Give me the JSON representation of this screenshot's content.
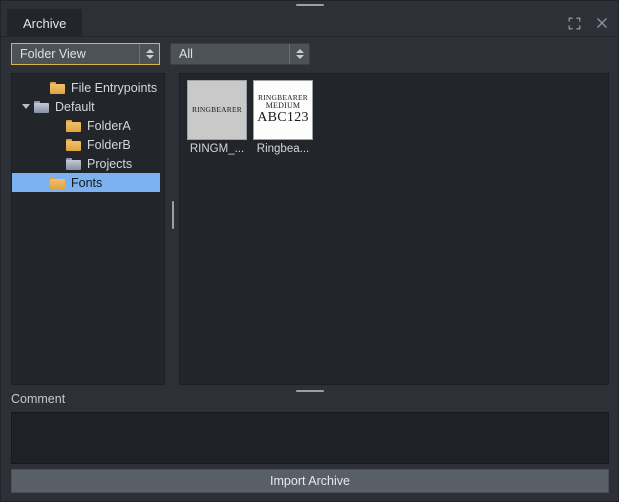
{
  "window": {
    "tab_label": "Archive",
    "expand_icon": "expand-icon",
    "close_icon": "close-icon"
  },
  "toolbar": {
    "view_combo": {
      "value": "Folder View",
      "focused": true
    },
    "filter_combo": {
      "value": "All",
      "focused": false
    }
  },
  "tree": {
    "items": [
      {
        "label": "File Entrypoints",
        "depth": 1,
        "folder_color": "orange",
        "expander": "none",
        "selected": false
      },
      {
        "label": "Default",
        "depth": 0,
        "folder_color": "blue",
        "expander": "expanded",
        "selected": false
      },
      {
        "label": "FolderA",
        "depth": 2,
        "folder_color": "orange",
        "expander": "none",
        "selected": false
      },
      {
        "label": "FolderB",
        "depth": 2,
        "folder_color": "orange",
        "expander": "none",
        "selected": false
      },
      {
        "label": "Projects",
        "depth": 2,
        "folder_color": "blue",
        "expander": "none",
        "selected": false
      },
      {
        "label": "Fonts",
        "depth": 1,
        "folder_color": "orange",
        "expander": "none",
        "selected": true
      }
    ]
  },
  "files": {
    "items": [
      {
        "label": "RINGM_...",
        "thumb_style": "gray",
        "preview_lines": [
          "RINGBEARER"
        ]
      },
      {
        "label": "Ringbea...",
        "thumb_style": "white",
        "preview_lines": [
          "RINGBEARER",
          "MEDIUM",
          "ABC123"
        ]
      }
    ]
  },
  "comment": {
    "label": "Comment",
    "value": ""
  },
  "actions": {
    "import_label": "Import Archive"
  },
  "colors": {
    "window_bg": "#2d3137",
    "panel_bg": "#22252a",
    "accent_focus": "#d8b544",
    "selection_blue": "#7cb2f0",
    "button_bg": "#595f66",
    "folder_orange": "#e2a33e",
    "folder_blue": "#8d99ae"
  }
}
